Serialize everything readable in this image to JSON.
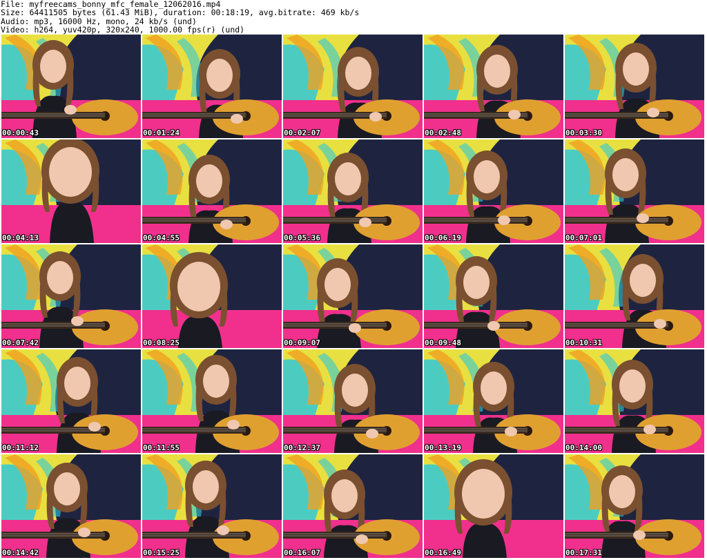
{
  "header": {
    "file": "File: myfreecams_bonny_mfc_female_12062016.mp4",
    "size": "Size: 64411505 bytes (61.43 MiB), duration: 00:18:19, avg.bitrate: 469 kb/s",
    "audio": "Audio: mp3, 16000 Hz, mono, 24 kb/s (und)",
    "video": "Video: h264, yuv420p, 320x240, 1000.00 fps(r) (und)"
  },
  "thumbnails": [
    {
      "time": "00:00:43"
    },
    {
      "time": "00:01:24"
    },
    {
      "time": "00:02:07"
    },
    {
      "time": "00:02:48"
    },
    {
      "time": "00:03:30"
    },
    {
      "time": "00:04:13"
    },
    {
      "time": "00:04:55"
    },
    {
      "time": "00:05:36"
    },
    {
      "time": "00:06:19"
    },
    {
      "time": "00:07:01"
    },
    {
      "time": "00:07:42"
    },
    {
      "time": "00:08:25"
    },
    {
      "time": "00:09:07"
    },
    {
      "time": "00:09:48"
    },
    {
      "time": "00:10:31"
    },
    {
      "time": "00:11:12"
    },
    {
      "time": "00:11:55"
    },
    {
      "time": "00:12:37"
    },
    {
      "time": "00:13:19"
    },
    {
      "time": "00:14:00"
    },
    {
      "time": "00:14:42"
    },
    {
      "time": "00:15:25"
    },
    {
      "time": "00:16:07"
    },
    {
      "time": "00:16:49"
    },
    {
      "time": "00:17:31"
    }
  ],
  "colors": {
    "wallpaper_yellow": "#e8e040",
    "wallpaper_cyan": "#30c8d8",
    "wallpaper_orange": "#f0a020",
    "backdrop_dark": "#1e2440",
    "pink_blanket": "#f0308c",
    "guitar_body": "#e0a030",
    "hair": "#7a5030",
    "skin": "#f0c8b0"
  }
}
